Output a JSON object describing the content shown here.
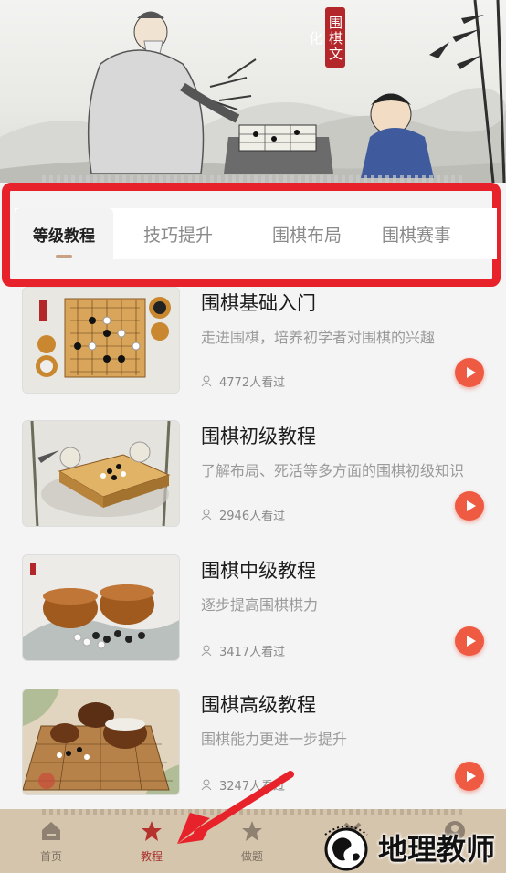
{
  "banner": {
    "seal_text": "围棋文化"
  },
  "tabs": [
    {
      "label": "等级教程",
      "active": true
    },
    {
      "label": "技巧提升",
      "active": false
    },
    {
      "label": "围棋布局",
      "active": false
    },
    {
      "label": "围棋赛事",
      "active": false
    }
  ],
  "courses": [
    {
      "title": "围棋基础入门",
      "desc": "走进围棋，培养初学者对围棋的兴趣",
      "views": "4772人看过"
    },
    {
      "title": "围棋初级教程",
      "desc": "了解布局、死活等多方面的围棋初级知识",
      "views": "2946人看过"
    },
    {
      "title": "围棋中级教程",
      "desc": "逐步提高围棋棋力",
      "views": "3417人看过"
    },
    {
      "title": "围棋高级教程",
      "desc": "围棋能力更进一步提升",
      "views": "3247人看过"
    }
  ],
  "bottom_nav": [
    {
      "label": "首页",
      "icon": "home-icon",
      "active": false
    },
    {
      "label": "教程",
      "icon": "star-icon",
      "active": true
    },
    {
      "label": "做题",
      "icon": "star-icon",
      "active": false
    },
    {
      "label": "",
      "icon": "tools-icon",
      "active": false
    },
    {
      "label": "",
      "icon": "user-icon",
      "active": false
    }
  ],
  "watermark": {
    "text": "地理教师"
  },
  "colors": {
    "accent_red": "#e8222a",
    "play_button": "#ef5a43",
    "nav_band": "#d6c5ad",
    "nav_active": "#a8322e"
  }
}
